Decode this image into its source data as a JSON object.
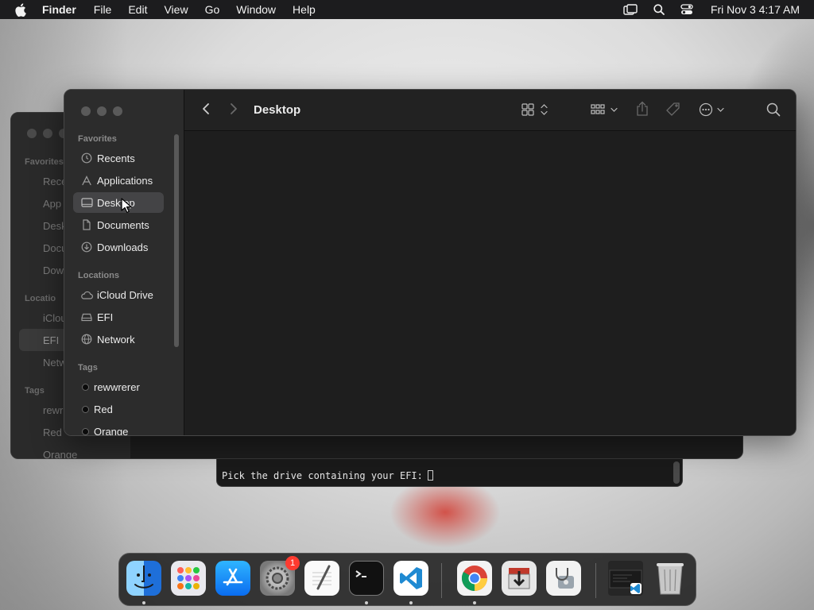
{
  "menubar": {
    "app_name": "Finder",
    "menus": [
      "File",
      "Edit",
      "View",
      "Go",
      "Window",
      "Help"
    ],
    "clock": "Fri Nov 3  4:17 AM"
  },
  "finder": {
    "title": "Desktop",
    "sidebar": {
      "favorites_label": "Favorites",
      "favorites": [
        {
          "label": "Recents",
          "icon": "clock-icon"
        },
        {
          "label": "Applications",
          "icon": "applications-icon"
        },
        {
          "label": "Desktop",
          "icon": "desktop-icon"
        },
        {
          "label": "Documents",
          "icon": "document-icon"
        },
        {
          "label": "Downloads",
          "icon": "download-icon"
        }
      ],
      "locations_label": "Locations",
      "locations": [
        {
          "label": "iCloud Drive",
          "icon": "cloud-icon"
        },
        {
          "label": "EFI",
          "icon": "drive-icon"
        },
        {
          "label": "Network",
          "icon": "globe-icon"
        }
      ],
      "tags_label": "Tags",
      "tags": [
        {
          "label": "rewwrerer"
        },
        {
          "label": "Red"
        },
        {
          "label": "Orange"
        }
      ],
      "selected": "Desktop"
    }
  },
  "background_window": {
    "favorites_label": "Favorites",
    "items": [
      "Rece",
      "App",
      "Desk",
      "Docu",
      "Dow"
    ],
    "locations_label": "Locatio",
    "locations": [
      "iClou",
      "EFI",
      "Netw"
    ],
    "tags_label": "Tags",
    "tags": [
      "rewr",
      "Red",
      "Orange"
    ]
  },
  "terminal": {
    "prompt": "Pick the drive containing your EFI:"
  },
  "dock": {
    "apps": [
      {
        "name": "finder-app",
        "running": true
      },
      {
        "name": "launchpad-app",
        "running": false
      },
      {
        "name": "app-store-app",
        "running": false
      },
      {
        "name": "system-settings-app",
        "running": false,
        "badge": "1"
      },
      {
        "name": "textedit-app",
        "running": false
      },
      {
        "name": "terminal-app",
        "running": true
      },
      {
        "name": "vscode-app",
        "running": true
      },
      {
        "name": "chrome-app",
        "running": true
      },
      {
        "name": "installer-app",
        "running": false
      },
      {
        "name": "disk-utility-app",
        "running": false
      },
      {
        "name": "minimized-window",
        "running": false
      },
      {
        "name": "trash-app",
        "running": false
      }
    ]
  },
  "colors": {
    "menubar": "#1c1c1e",
    "window_bg": "#1e1e1e",
    "sidebar_bg": "#2c2c2c",
    "selection": "#444446",
    "badge": "#ff3b30"
  }
}
